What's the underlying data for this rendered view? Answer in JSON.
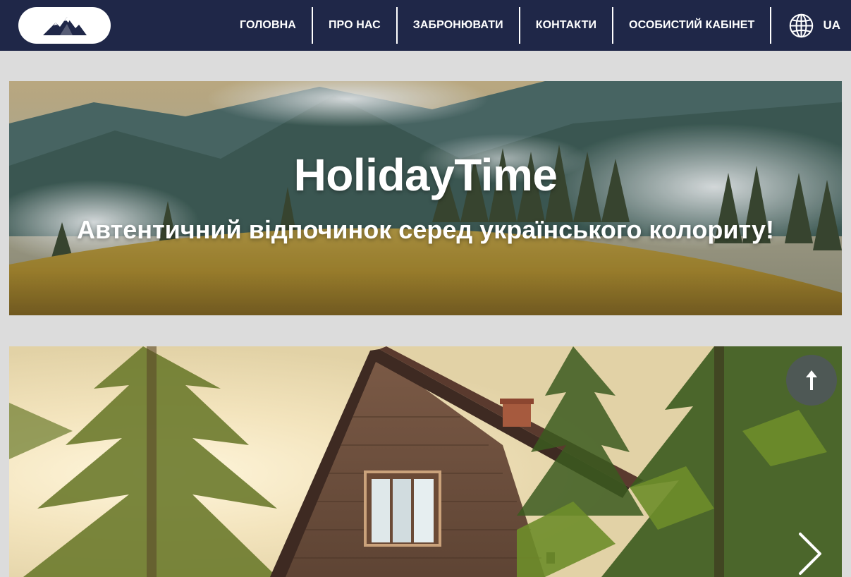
{
  "header": {
    "logo_icon": "mountains-icon",
    "nav": [
      {
        "label": "ГОЛОВНА"
      },
      {
        "label": "ПРО НАС"
      },
      {
        "label": "ЗАБРОНЮВАТИ"
      },
      {
        "label": "КОНТАКТИ"
      },
      {
        "label": "ОСОБИСТИЙ КАБІНЕТ"
      }
    ],
    "language": {
      "icon": "globe-icon",
      "label": "UA"
    }
  },
  "hero": {
    "title": "HolidayTime",
    "subtitle": "Автентичний відпочинок серед українського колориту!"
  },
  "slider": {
    "scroll_top_icon": "arrow-up-icon",
    "next_icon": "chevron-right-icon"
  },
  "colors": {
    "header_bg": "#1f2748",
    "page_bg": "#dcdcdc",
    "text_light": "#ffffff"
  }
}
